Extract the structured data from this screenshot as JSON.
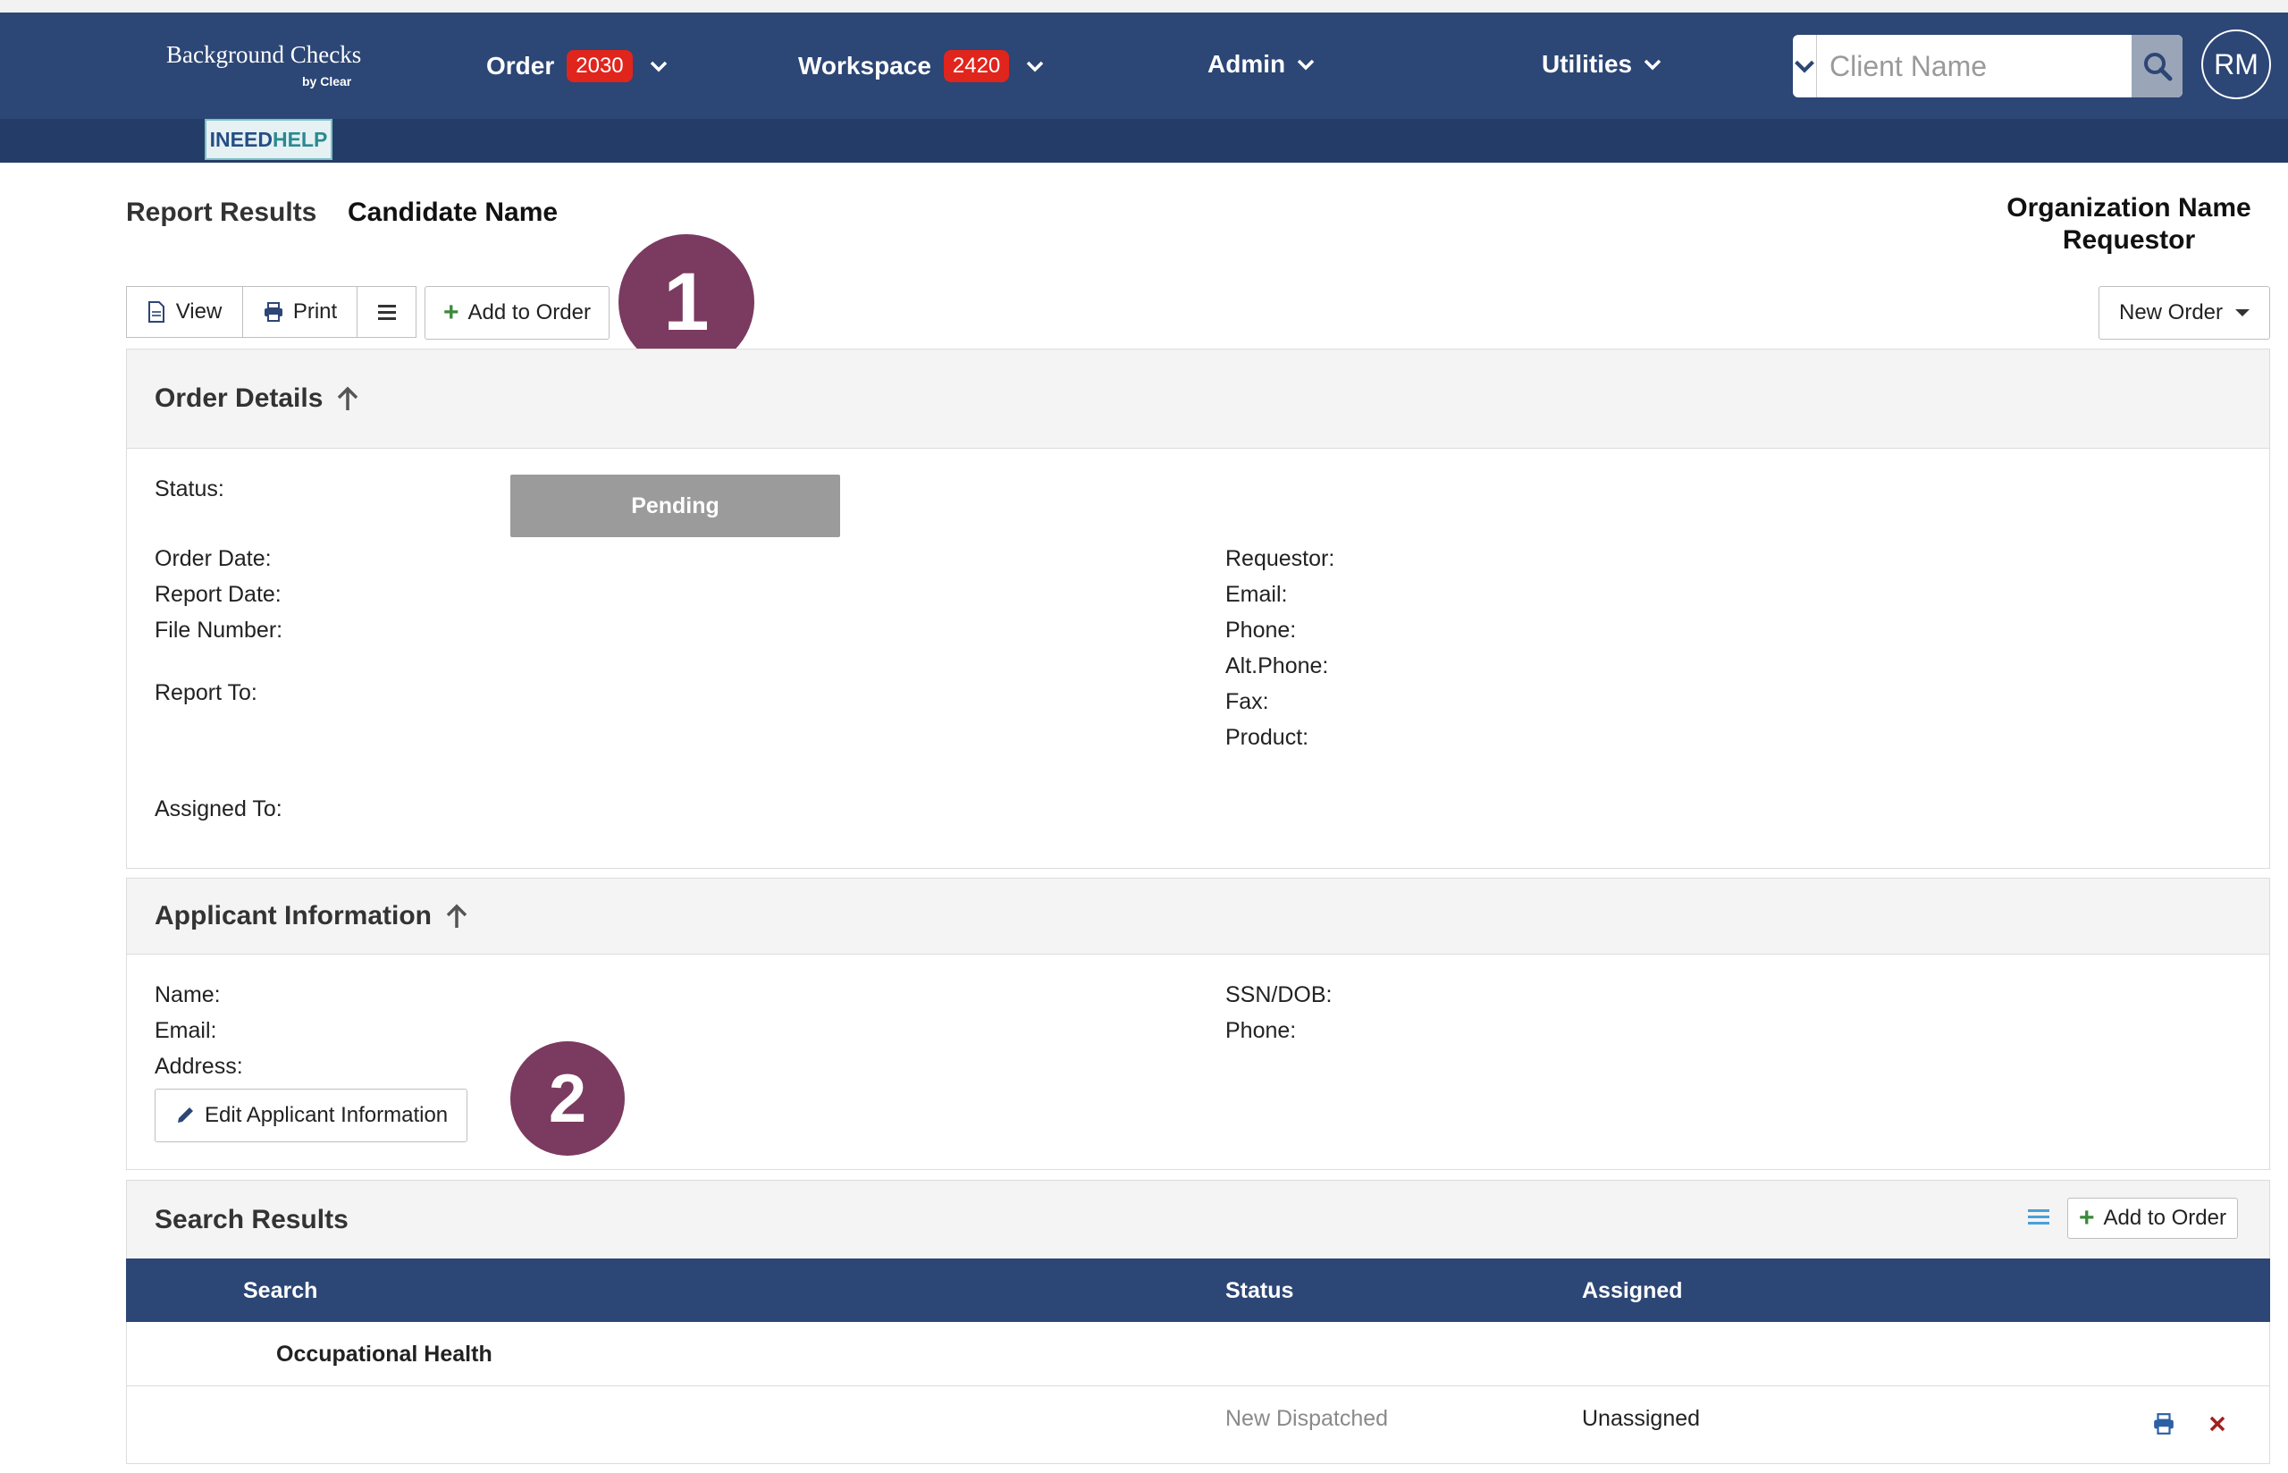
{
  "header": {
    "logo_title": "Background Checks",
    "logo_sub": "by Clear",
    "help_left": "INEED",
    "help_right": "HELP",
    "nav": [
      {
        "label": "Order",
        "badge": "2030"
      },
      {
        "label": "Workspace",
        "badge": "2420"
      },
      {
        "label": "Admin"
      },
      {
        "label": "Utilities"
      }
    ],
    "search_placeholder": "Client Name",
    "avatar_initials": "RM"
  },
  "page": {
    "title": "Report Results",
    "candidate": "Candidate Name",
    "org_name": "Organization Name",
    "requestor": "Requestor"
  },
  "toolbar": {
    "view": "View",
    "print": "Print",
    "add_to_order": "Add to Order",
    "new_order": "New Order"
  },
  "callouts": [
    "1",
    "2"
  ],
  "order_details": {
    "title": "Order Details",
    "status_label": "Status:",
    "status_value": "Pending",
    "left_labels": [
      "Order Date:",
      "Report Date:",
      "File Number:"
    ],
    "report_to": "Report To:",
    "assigned_to": "Assigned To:",
    "right_labels": [
      "Requestor:",
      "Email:",
      "Phone:",
      "Alt.Phone:",
      "Fax:",
      "Product:"
    ]
  },
  "applicant": {
    "title": "Applicant Information",
    "left_labels": [
      "Name:",
      "Email:",
      "Address:"
    ],
    "right_labels": [
      "SSN/DOB:",
      "Phone:"
    ],
    "edit_button": "Edit Applicant Information"
  },
  "search_results": {
    "title": "Search Results",
    "add_to_order": "Add to Order",
    "columns": [
      "Search",
      "Status",
      "Assigned"
    ],
    "group": "Occupational Health",
    "rows": [
      {
        "search": "",
        "status": "New Dispatched",
        "assigned": "Unassigned"
      }
    ]
  },
  "colors": {
    "navbar": "#2c4675",
    "badge": "#e0251d",
    "callout": "#7b3a5f",
    "pending": "#9b9b9b"
  }
}
